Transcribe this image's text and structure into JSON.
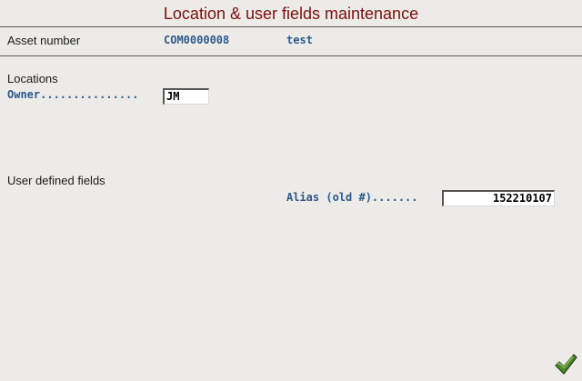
{
  "window": {
    "title": "Location & user fields maintenance"
  },
  "header": {
    "asset_number_label": "Asset number",
    "asset_number_value": "COM0000008",
    "asset_description": "test"
  },
  "locations": {
    "section_label": "Locations",
    "owner_label": "Owner...............",
    "owner_value": "JM"
  },
  "user_defined_fields": {
    "section_label": "User defined fields",
    "alias_label": "Alias (old #).......",
    "alias_value": "152210107"
  },
  "actions": {
    "confirm_icon": "checkmark-icon",
    "confirm_color": "#4f8a2a"
  }
}
